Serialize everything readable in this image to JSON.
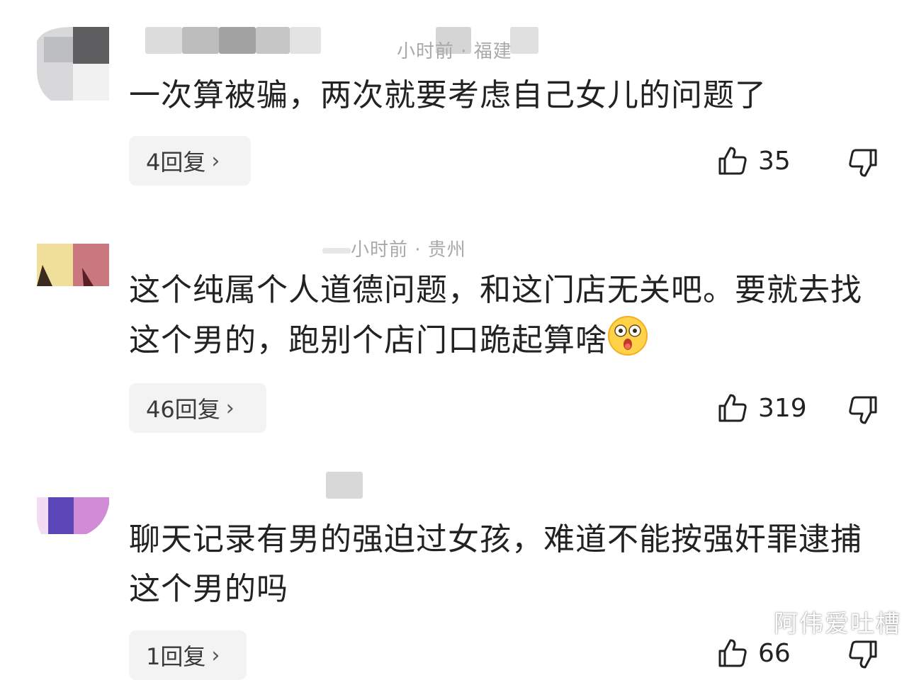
{
  "comments": [
    {
      "meta": "小时前 · 福建",
      "text": "一次算被骗，两次就要考虑自己女儿的问题了",
      "replies_label": "4回复",
      "likes": "35"
    },
    {
      "meta": "小时前 · 贵州",
      "text": "这个纯属个人道德问题，和这门店无关吧。要就去找这个男的，跑别个店门口跪起算啥",
      "replies_label": "46回复",
      "likes": "319"
    },
    {
      "meta": "",
      "text": "聊天记录有男的强迫过女孩，难道不能按强奸罪逮捕这个男的吗",
      "replies_label": "1回复",
      "likes": "66"
    }
  ],
  "icons": {
    "like": "thumbs-up-icon",
    "dislike": "thumbs-down-icon",
    "emoji": "astonished-face-emoji",
    "chevron": "chevron-right-icon"
  },
  "watermark": "阿伟爱吐槽"
}
